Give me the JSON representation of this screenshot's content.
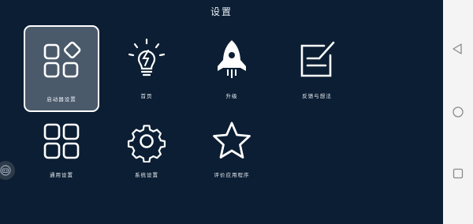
{
  "header": {
    "title": "设置"
  },
  "tiles": [
    {
      "label": "启动器设置",
      "icon": "apps-grid-icon"
    },
    {
      "label": "首页",
      "icon": "lightbulb-icon"
    },
    {
      "label": "升级",
      "icon": "rocket-icon"
    },
    {
      "label": "反馈与想法",
      "icon": "feedback-edit-icon"
    },
    {
      "label": "通用设置",
      "icon": "grid-icon"
    },
    {
      "label": "系统设置",
      "icon": "gear-icon"
    },
    {
      "label": "评价应用程序",
      "icon": "star-icon"
    }
  ],
  "selected_tile": "启动器设置",
  "colors": {
    "background": "#0c1e33",
    "selected_tile_bg": "#4b5a6b",
    "navbar_bg": "#f4f4f4"
  }
}
